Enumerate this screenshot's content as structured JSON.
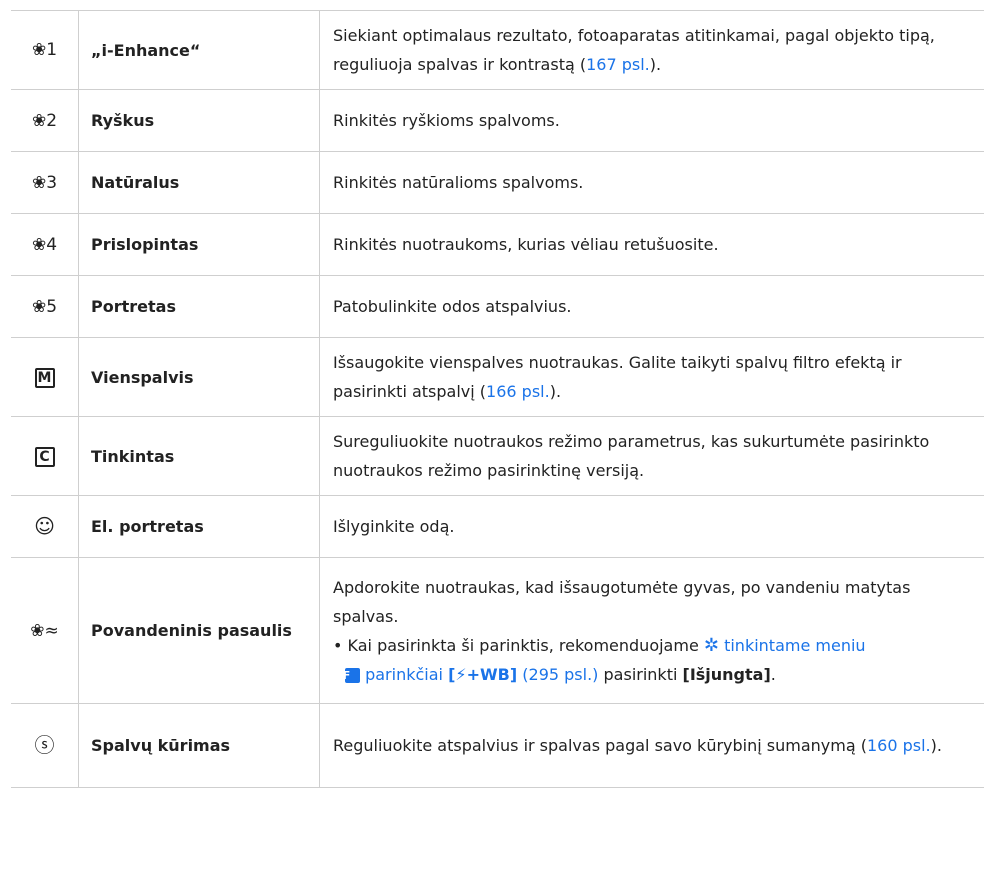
{
  "rows": [
    {
      "icon": "portrait-1-icon",
      "icon_glyph": "❀1",
      "name": "„i-Enhance“",
      "desc_a": "Siekiant optimalaus rezultato, fotoaparatas atitinkamai, pagal objekto tipą, reguliuoja spalvas ir kontrastą (",
      "link": "167 psl.",
      "desc_b": ")."
    },
    {
      "icon": "portrait-2-icon",
      "icon_glyph": "❀2",
      "name": "Ryškus",
      "desc": "Rinkitės ryškioms spalvoms."
    },
    {
      "icon": "portrait-3-icon",
      "icon_glyph": "❀3",
      "name": "Natūralus",
      "desc": "Rinkitės natūralioms spalvoms."
    },
    {
      "icon": "portrait-4-icon",
      "icon_glyph": "❀4",
      "name": "Prislopintas",
      "desc": "Rinkitės nuotraukoms, kurias vėliau retušuosite."
    },
    {
      "icon": "portrait-5-icon",
      "icon_glyph": "❀5",
      "name": "Portretas",
      "desc": "Patobulinkite odos atspalvius."
    },
    {
      "icon": "monochrome-icon",
      "icon_glyph": "M",
      "name": "Vienspalvis",
      "desc_a": "Išsaugokite vienspalves nuotraukas. Galite taikyti spalvų filtro efektą ir pasirinkti atspalvį (",
      "link": "166 psl.",
      "desc_b": ")."
    },
    {
      "icon": "custom-icon",
      "icon_glyph": "C",
      "name": "Tinkintas",
      "desc": "Sureguliuokite nuotraukos režimo parametrus, kas sukurtumėte pasirinkto nuotraukos režimo pasirinktinę versiją."
    },
    {
      "icon": "e-portrait-icon",
      "icon_glyph": "☺",
      "name": "El. portretas",
      "desc": "Išlyginkite odą."
    },
    {
      "icon": "underwater-icon",
      "icon_glyph": "❀≈",
      "name": "Povandeninis pasaulis",
      "desc": "Apdorokite nuotraukas, kad išsaugotumėte gyvas, po vandeniu matytas spalvas.",
      "bullet_a": "Kai pasirinkta ši parinktis, rekomenduojame",
      "bullet_link_a": "tinkintame meniu",
      "bullet_link_b": "parinkčiai",
      "bullet_bold_a": "[",
      "bullet_bold_b": "+WB]",
      "bullet_ref": "(295 psl.)",
      "bullet_mid": "pasirinkti",
      "bullet_bold_c": "[Išjungta]",
      "bullet_end": "."
    },
    {
      "icon": "color-creator-icon",
      "icon_glyph": "ⓢ",
      "name": "Spalvų kūrimas",
      "desc_a": "Reguliuokite atspalvius ir spalvas pagal savo kūrybinį sumanymą (",
      "link": "160 psl.",
      "desc_b": ")."
    }
  ],
  "colors": {
    "link": "#1a73e8",
    "border": "#cfcfcf"
  }
}
